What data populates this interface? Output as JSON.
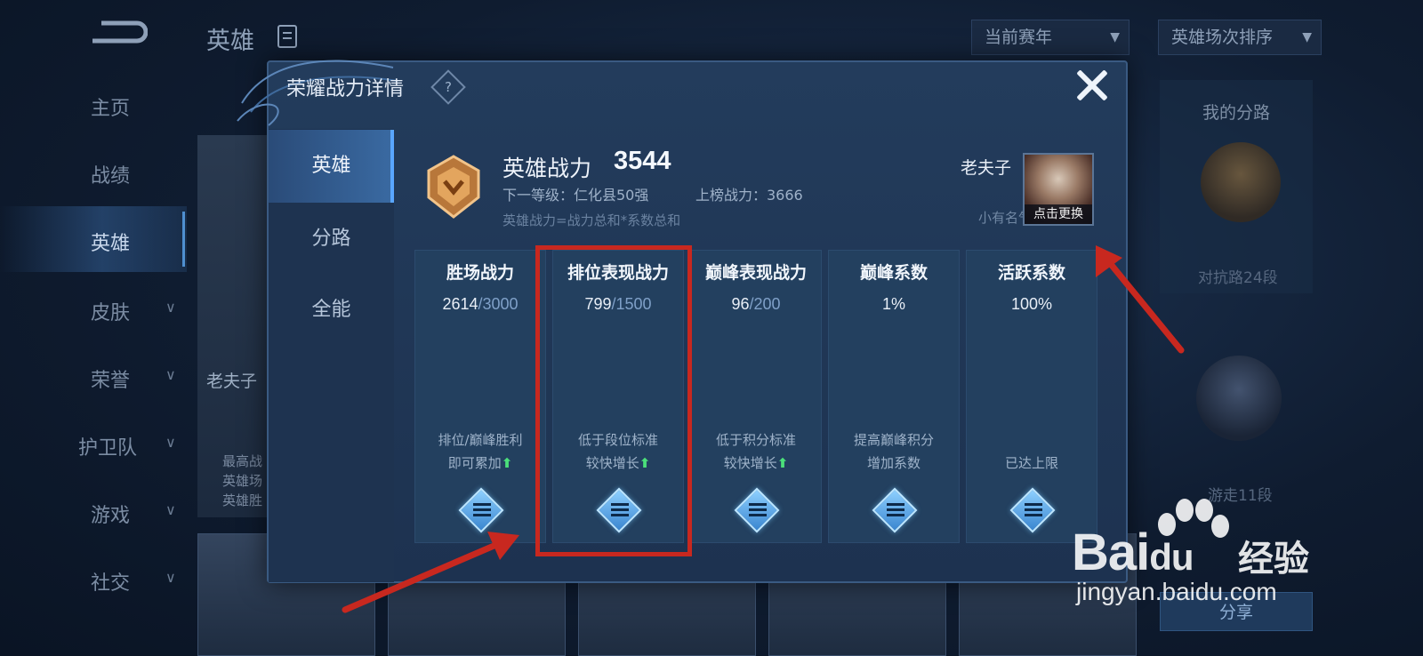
{
  "background": {
    "page_title": "英雄",
    "season_select": "当前赛年",
    "sort_select": "英雄场次排序",
    "sidebar": [
      {
        "label": "主页",
        "chevron": false
      },
      {
        "label": "战绩",
        "chevron": false
      },
      {
        "label": "英雄",
        "chevron": false,
        "active": true
      },
      {
        "label": "皮肤",
        "chevron": true
      },
      {
        "label": "荣誉",
        "chevron": true
      },
      {
        "label": "护卫队",
        "chevron": true
      },
      {
        "label": "游戏",
        "chevron": true
      },
      {
        "label": "社交",
        "chevron": true
      }
    ],
    "card_name": "老夫子",
    "card_lines": [
      "最高战",
      "英雄场",
      "英雄胜"
    ],
    "right_panel": {
      "title": "我的分路",
      "lane1": "对抗路24段",
      "lane2": "游走11段",
      "button": "分享"
    }
  },
  "modal": {
    "title": "荣耀战力详情",
    "help_glyph": "?",
    "tabs": [
      "英雄",
      "分路",
      "全能"
    ],
    "active_tab": 0,
    "power_label": "英雄战力",
    "power_value": "3544",
    "next_level": "下一等级：仁化县50强",
    "list_power": "上榜战力：3666",
    "formula": "英雄战力=战力总和*系数总和",
    "hero_name": "老夫子",
    "hero_rank": "小有名气",
    "avatar_button": "点击更换",
    "stats": [
      {
        "title": "胜场战力",
        "value": "2614",
        "max": "3000",
        "hint1": "排位/巅峰胜利",
        "hint2": "即可累加",
        "arrow": "⬆"
      },
      {
        "title": "排位表现战力",
        "value": "799",
        "max": "1500",
        "hint1": "低于段位标准",
        "hint2": "较快增长",
        "arrow": "⬆"
      },
      {
        "title": "巅峰表现战力",
        "value": "96",
        "max": "200",
        "hint1": "低于积分标准",
        "hint2": "较快增长",
        "arrow": "⬆"
      },
      {
        "title": "巅峰系数",
        "value": "1%",
        "max": "",
        "hint1": "提高巅峰积分",
        "hint2": "增加系数",
        "arrow": ""
      },
      {
        "title": "活跃系数",
        "value": "100%",
        "max": "",
        "hint1": "",
        "hint2": "已达上限",
        "arrow": ""
      }
    ]
  },
  "watermark": {
    "brand": "Bai",
    "brand_du": "du",
    "brand_cn": "经验",
    "url": "jingyan.baidu.com"
  },
  "colors": {
    "highlight": "#c8281f",
    "accent": "#59a6ff",
    "up_arrow": "#4be07a"
  }
}
